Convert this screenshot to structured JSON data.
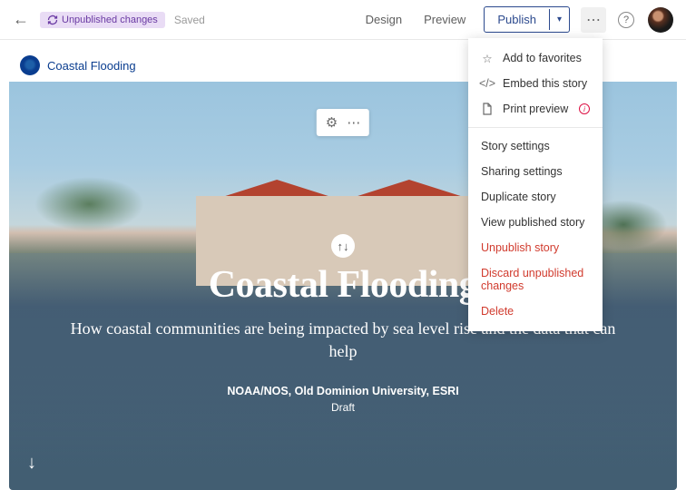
{
  "topbar": {
    "unpublished_label": "Unpublished changes",
    "saved_label": "Saved",
    "design_label": "Design",
    "preview_label": "Preview",
    "publish_label": "Publish"
  },
  "dropdown": {
    "add_favorites": "Add to favorites",
    "embed": "Embed this story",
    "print": "Print preview",
    "story_settings": "Story settings",
    "sharing_settings": "Sharing settings",
    "duplicate": "Duplicate story",
    "view_published": "View published story",
    "unpublish": "Unpublish story",
    "discard": "Discard unpublished changes",
    "delete": "Delete"
  },
  "brand": {
    "name": "Coastal Flooding"
  },
  "hero": {
    "title": "Coastal Flooding",
    "subtitle": "How coastal communities are being impacted by sea level rise and the data that can help",
    "byline": "NOAA/NOS, Old Dominion University, ESRI",
    "status": "Draft"
  }
}
